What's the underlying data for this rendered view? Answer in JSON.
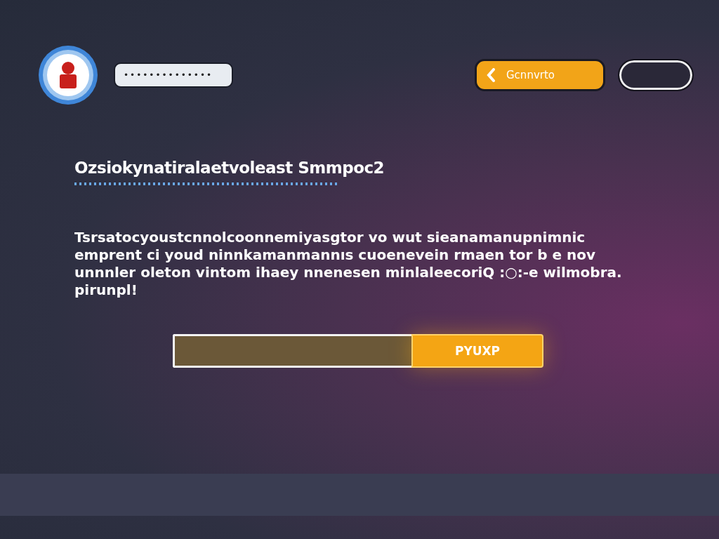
{
  "header": {
    "name_field": {
      "value": "••••••••••••••"
    },
    "back_button": {
      "label": "Gcnnvrto"
    }
  },
  "title": "Ozsiokynatiralaetvoleast Smmpoc2",
  "body": "Tsrsatocyoustcnnolcoonnemiyasgtor vo wut sieanamanupnimnic emprent ci youd ninnkamanmannıs cuoenevein rmaen tor b e nov unnnler oleton vintom ihaey nnenesen minlaleecoriQ :○:-e  wilmobra. pirunpl!",
  "form": {
    "submit_button": {
      "label": "PYUXP"
    }
  }
}
